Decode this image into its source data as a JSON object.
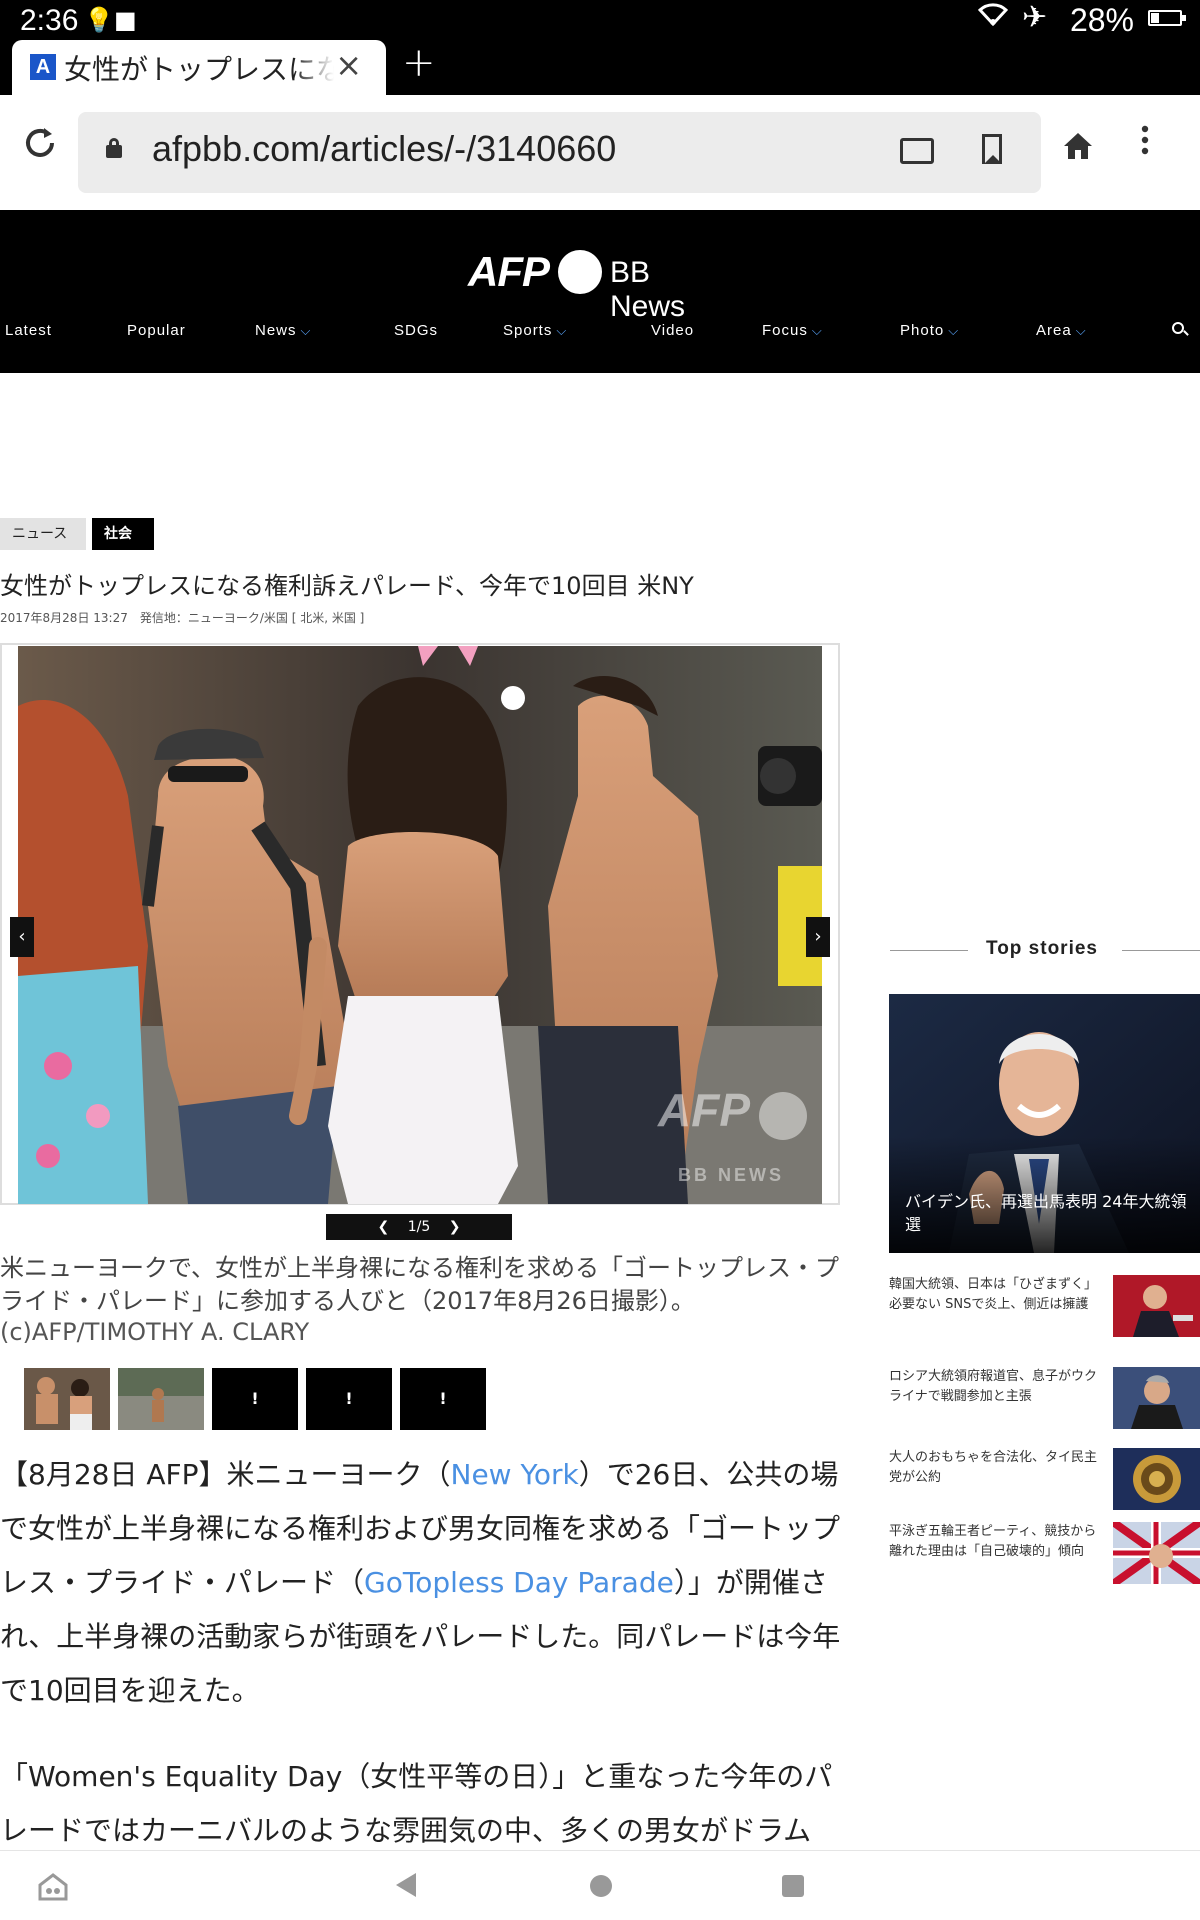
{
  "status_bar": {
    "time": "2:36",
    "battery": "28%",
    "battery_level": 0.28
  },
  "browser": {
    "tab_title": "女性がトップレスになる権利訴えパレード",
    "new_tab_symbol": "+",
    "close_symbol": "×",
    "favicon_letter": "A",
    "url": "afpbb.com/articles/-/3140660"
  },
  "site": {
    "logo_afp": "AFP",
    "logo_bb": "BB News",
    "nav": [
      {
        "label": "Latest",
        "dropdown": false
      },
      {
        "label": "Popular",
        "dropdown": false
      },
      {
        "label": "News",
        "dropdown": true
      },
      {
        "label": "SDGs",
        "dropdown": false
      },
      {
        "label": "Sports",
        "dropdown": true
      },
      {
        "label": "Video",
        "dropdown": false
      },
      {
        "label": "Focus",
        "dropdown": true
      },
      {
        "label": "Photo",
        "dropdown": true
      },
      {
        "label": "Area",
        "dropdown": true
      }
    ]
  },
  "article": {
    "tags": [
      "ニュース",
      "社会"
    ],
    "headline": "女性がトップレスになる権利訴えパレード、今年で10回目 米NY",
    "dateline": "2017年8月28日 13:27　発信地：ニューヨーク/米国 [ 北米, 米国 ]",
    "photo_watermark": "AFP",
    "photo_watermark_sub": "BB NEWS",
    "counter": "1/5",
    "caption": "米ニューヨークで、女性が上半身裸になる権利を求める「ゴートップレス・プライド・パレード」に参加する人びと（2017年8月26日撮影）。",
    "credit": "(c)AFP/TIMOTHY A. CLARY",
    "thumb_placeholder": "!",
    "p1_a": "【8月28日 AFP】米ニューヨーク（",
    "p1_link1": "New York",
    "p1_b": "）で26日、公共の場で女性が上半身裸になる権利および男女同権を求める「ゴートップレス・プライド・パレード（",
    "p1_link2": "GoTopless Day Parade",
    "p1_c": "）」が開催され、上半身裸の活動家らが街頭をパレードした。同パレードは今年で10回目を迎えた。",
    "p2": "「Women's Equality Day（女性平等の日）」と重なった今年のパレードではカーニバルのような雰囲気の中、多くの男女がドラム"
  },
  "sidebar": {
    "heading": "Top stories",
    "feature_caption": "バイデン氏、再選出馬表明 24年大統領選",
    "stories": [
      {
        "text": "韓国大統領、日本は「ひざまずく」必要ない SNSで炎上、側近は擁護"
      },
      {
        "text": "ロシア大統領府報道官、息子がウクライナで戦闘参加と主張"
      },
      {
        "text": "大人のおもちゃを合法化、タイ民主党が公約"
      },
      {
        "text": "平泳ぎ五輪王者ピーティ、競技から離れた理由は「自己破壊的」傾向"
      }
    ]
  },
  "colors": {
    "link": "#4a90e2",
    "nav_chevron": "#5aa7ff",
    "header_bg": "#000000"
  },
  "icons": [
    "reload-icon",
    "lock-icon",
    "cast-icon",
    "bookmark-icon",
    "home-icon",
    "more-icon",
    "search-icon",
    "wifi-icon",
    "airplane-icon",
    "bulb-icon"
  ]
}
